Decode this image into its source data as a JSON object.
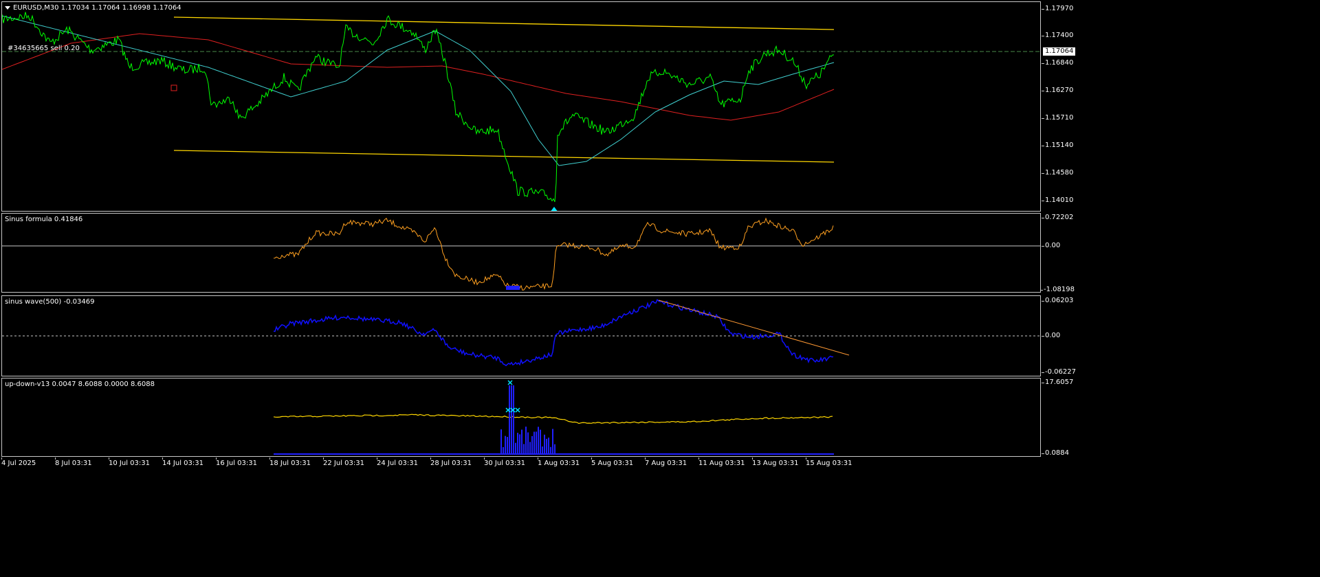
{
  "main": {
    "symbol_line": "EURUSD,M30  1.17034 1.17064 1.16998 1.17064",
    "order_label": "#34635665 sell 0.20",
    "price_ticks": [
      "1.17970",
      "1.17400",
      "1.16840",
      "1.16270",
      "1.15710",
      "1.15140",
      "1.14580",
      "1.14010"
    ],
    "current_price": "1.17064"
  },
  "sinus_formula": {
    "label": "Sinus formula 0.41846",
    "ticks": [
      "0.72202",
      "0.00",
      "-1.08198"
    ]
  },
  "sinus_wave": {
    "label": "sinus wave(500) -0.03469",
    "ticks": [
      "0.06203",
      "0.00",
      "-0.06227"
    ]
  },
  "updown": {
    "label": "up-down-v13 0.0047 8.6088 0.0000 8.6088",
    "ticks": [
      "17.6057",
      "0.0884"
    ]
  },
  "time_labels": [
    "4 Jul 2025",
    "8 Jul 03:31",
    "10 Jul 03:31",
    "14 Jul 03:31",
    "16 Jul 03:31",
    "18 Jul 03:31",
    "22 Jul 03:31",
    "24 Jul 03:31",
    "28 Jul 03:31",
    "30 Jul 03:31",
    "1 Aug 03:31",
    "5 Aug 03:31",
    "7 Aug 03:31",
    "11 Aug 03:31",
    "13 Aug 03:31",
    "15 Aug 03:31"
  ],
  "colors": {
    "price": "#00ff00",
    "ma_fast": "#40d0d0",
    "ma_slow": "#e02020",
    "channel": "#ffd700",
    "sinus_formula": "#ffa020",
    "sinus_wave": "#1010ff",
    "trend": "#ff9933",
    "histogram": "#2020ff",
    "updown_line": "#ffd700",
    "marker": "#00e5ff"
  }
}
